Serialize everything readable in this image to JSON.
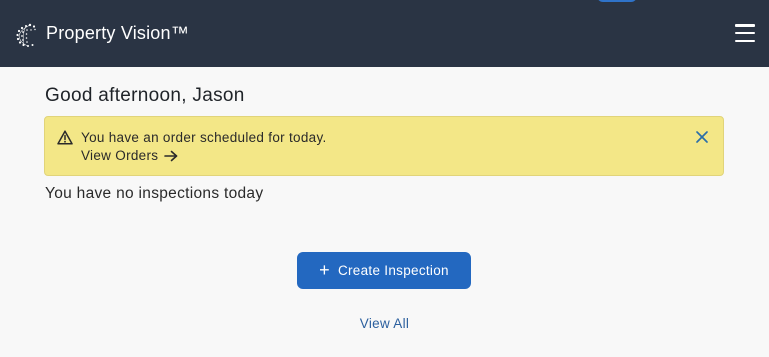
{
  "header": {
    "title": "Property Vision™",
    "logo_icon": "globe-mesh-icon",
    "menu_icon": "hamburger-menu-icon"
  },
  "main": {
    "greeting": "Good afternoon, Jason",
    "alert": {
      "icon": "warning-icon",
      "message": "You have an order scheduled for today.",
      "link_label": "View Orders",
      "link_icon": "arrow-right-icon",
      "close_icon": "close-icon",
      "background": "#f3e787"
    },
    "status_text": "You have no inspections today",
    "create_button": {
      "icon": "plus-icon",
      "plus_glyph": "+",
      "label": "Create Inspection",
      "color": "#2368c0"
    },
    "view_all_label": "View All"
  },
  "colors": {
    "header_bg": "#2a3444",
    "page_bg": "#f8f8f8",
    "link": "#2b5f9e"
  }
}
